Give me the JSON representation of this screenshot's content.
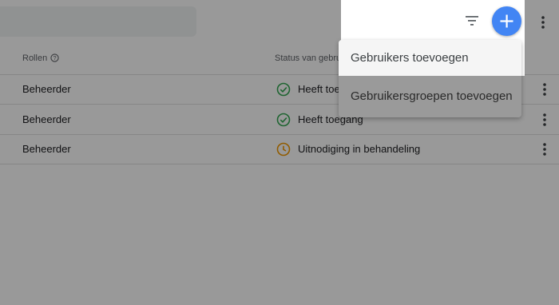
{
  "table": {
    "headers": {
      "roles": "Rollen",
      "status": "Status van gebru"
    },
    "rows": [
      {
        "role": "Beheerder",
        "status": "Heeft toe",
        "status_kind": "granted",
        "status_icon": "check-circle-icon"
      },
      {
        "role": "Beheerder",
        "status": "Heeft toegang",
        "status_kind": "granted",
        "status_icon": "check-circle-icon"
      },
      {
        "role": "Beheerder",
        "status": "Uitnodiging in behandeling",
        "status_kind": "pending",
        "status_icon": "clock-icon"
      }
    ]
  },
  "toolbar": {
    "filter_icon": "filter-icon",
    "add_icon": "plus-icon",
    "more_icon": "more-vert-icon"
  },
  "add_menu": {
    "items": [
      {
        "label": "Gebruikers toevoegen"
      },
      {
        "label": "Gebruikersgroepen toevoegen"
      }
    ]
  },
  "colors": {
    "accent": "#4285f4",
    "granted": "#34a853",
    "pending": "#f29900",
    "scrim": "rgba(0,0,0,0.4)"
  }
}
